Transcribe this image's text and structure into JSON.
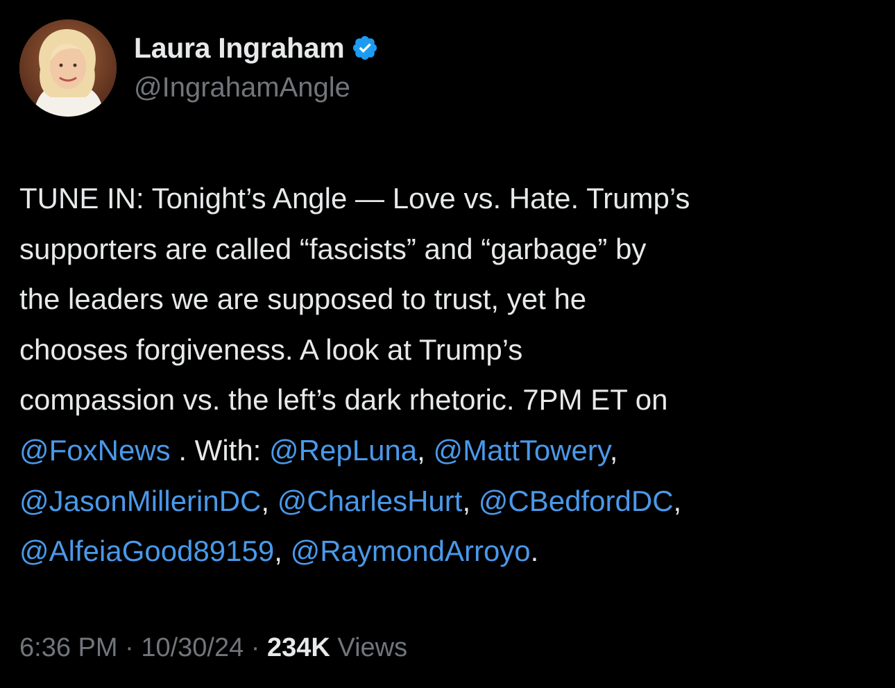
{
  "author": {
    "display_name": "Laura Ingraham",
    "handle": "@IngrahamAngle",
    "verified": true,
    "avatar_icon": "profile-photo"
  },
  "tweet": {
    "segments": [
      {
        "type": "text",
        "value": "TUNE IN: Tonight’s Angle — Love vs. Hate. Trump’s\nsupporters are called “fascists” and “garbage” by\nthe leaders we are supposed to trust, yet he\nchooses forgiveness. A look at Trump’s\ncompassion vs. the left’s dark rhetoric. 7PM ET on\n"
      },
      {
        "type": "mention",
        "value": "@FoxNews"
      },
      {
        "type": "text",
        "value": " . With: "
      },
      {
        "type": "mention",
        "value": "@RepLuna"
      },
      {
        "type": "text",
        "value": ", "
      },
      {
        "type": "mention",
        "value": "@MattTowery"
      },
      {
        "type": "text",
        "value": ",\n"
      },
      {
        "type": "mention",
        "value": "@JasonMillerinDC"
      },
      {
        "type": "text",
        "value": ", "
      },
      {
        "type": "mention",
        "value": "@CharlesHurt"
      },
      {
        "type": "text",
        "value": ", "
      },
      {
        "type": "mention",
        "value": "@CBedfordDC"
      },
      {
        "type": "text",
        "value": ",\n"
      },
      {
        "type": "mention",
        "value": "@AlfeiaGood89159"
      },
      {
        "type": "text",
        "value": ", "
      },
      {
        "type": "mention",
        "value": "@RaymondArroyo"
      },
      {
        "type": "text",
        "value": "."
      }
    ]
  },
  "meta": {
    "time": "6:36 PM",
    "separator": " · ",
    "date": "10/30/24",
    "views_count": "234K",
    "views_label": " Views"
  },
  "colors": {
    "background": "#000000",
    "text": "#e7e9ea",
    "secondary": "#71767b",
    "link": "#4a99e9",
    "verified": "#1d9bf0"
  }
}
